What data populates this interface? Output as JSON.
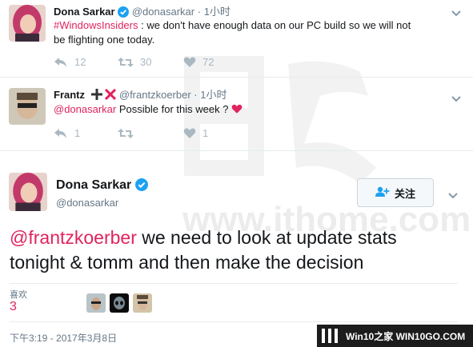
{
  "tweet1": {
    "name": "Dona Sarkar",
    "handle": "@donasarkar",
    "separator": "·",
    "time": "1小时",
    "hashtag": "#WindowsInsiders",
    "text_line1": " : we don't have enough data on our PC build so we will not",
    "text_line2": "be flighting one today.",
    "reply_count": "12",
    "retweet_count": "30",
    "like_count": "72"
  },
  "tweet2": {
    "name": "Frantz",
    "handle": "@frantzkoerber",
    "separator": "·",
    "time": "1小时",
    "mention": "@donasarkar",
    "text": " Possible for this week ?",
    "reply_count": "1",
    "like_count": "1"
  },
  "main_tweet": {
    "name": "Dona Sarkar",
    "handle": "@donasarkar",
    "follow_label": "关注",
    "mention": "@frantzkoerber",
    "text_line1": " we need to look at update stats",
    "text_line2": "tonight & tomm and then make the decision",
    "likes_label": "喜欢",
    "likes_count": "3",
    "timestamp": "下午3:19 - 2017年3月8日"
  },
  "watermark": {
    "text": "www.ithome.com"
  },
  "site_badge": {
    "label": "Win10之家 WIN10GO.COM"
  },
  "colors": {
    "accent": "#e0245e",
    "verified": "#1da1f2",
    "muted": "#657786",
    "icon": "#aab8c2"
  },
  "icons": [
    "verified-icon",
    "plus-icon",
    "cross-icon",
    "reply-icon",
    "retweet-icon",
    "heart-icon",
    "add-user-icon",
    "chevron-down-icon",
    "heart-emoji-icon"
  ]
}
